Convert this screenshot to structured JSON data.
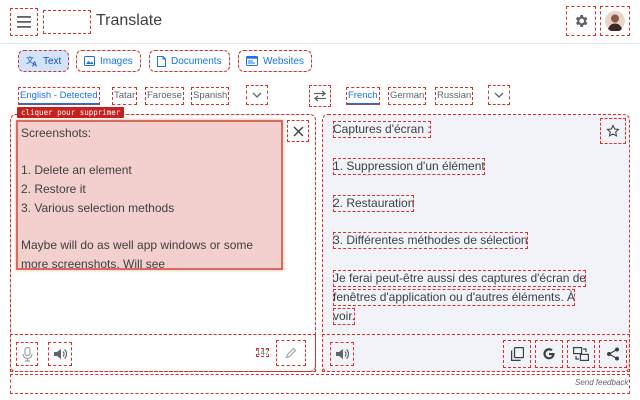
{
  "header": {
    "title": "Translate",
    "menu_icon": "hamburger-menu-icon",
    "settings_icon": "gear-icon",
    "avatar_icon": "user-avatar"
  },
  "modes": [
    {
      "label": "Text",
      "icon": "translate-icon",
      "active": true
    },
    {
      "label": "Images",
      "icon": "image-icon",
      "active": false
    },
    {
      "label": "Documents",
      "icon": "document-icon",
      "active": false
    },
    {
      "label": "Websites",
      "icon": "website-icon",
      "active": false
    }
  ],
  "source_languages": [
    "English - Detected",
    "Tatar",
    "Faroese",
    "Spanish"
  ],
  "target_languages": [
    "French",
    "German",
    "Russian"
  ],
  "source": {
    "delete_tag": "cliquer pour supprimer",
    "lines": [
      "Screenshots:",
      "",
      "1. Delete an element",
      "2. Restore it",
      "3. Various selection methods",
      "",
      "Maybe will do as well app windows or some",
      "more screenshots. Will see"
    ],
    "char_count": "147"
  },
  "target": {
    "lines": [
      "Captures d'écran :",
      "1. Suppression d'un élément",
      "2. Restauration",
      "3. Différentes méthodes de sélection",
      "Je ferai peut-être aussi des captures d'écran de",
      "fenêtres d'application ou d'autres éléments. À",
      "voir."
    ]
  },
  "footer": {
    "feedback": "Send feedback"
  },
  "colors": {
    "accent": "#1a73e8",
    "active_tab_bg": "#d2e3fc",
    "target_bg": "#f1f3f8",
    "highlight": "#d96b5c",
    "tag_bg": "#c5221f"
  }
}
